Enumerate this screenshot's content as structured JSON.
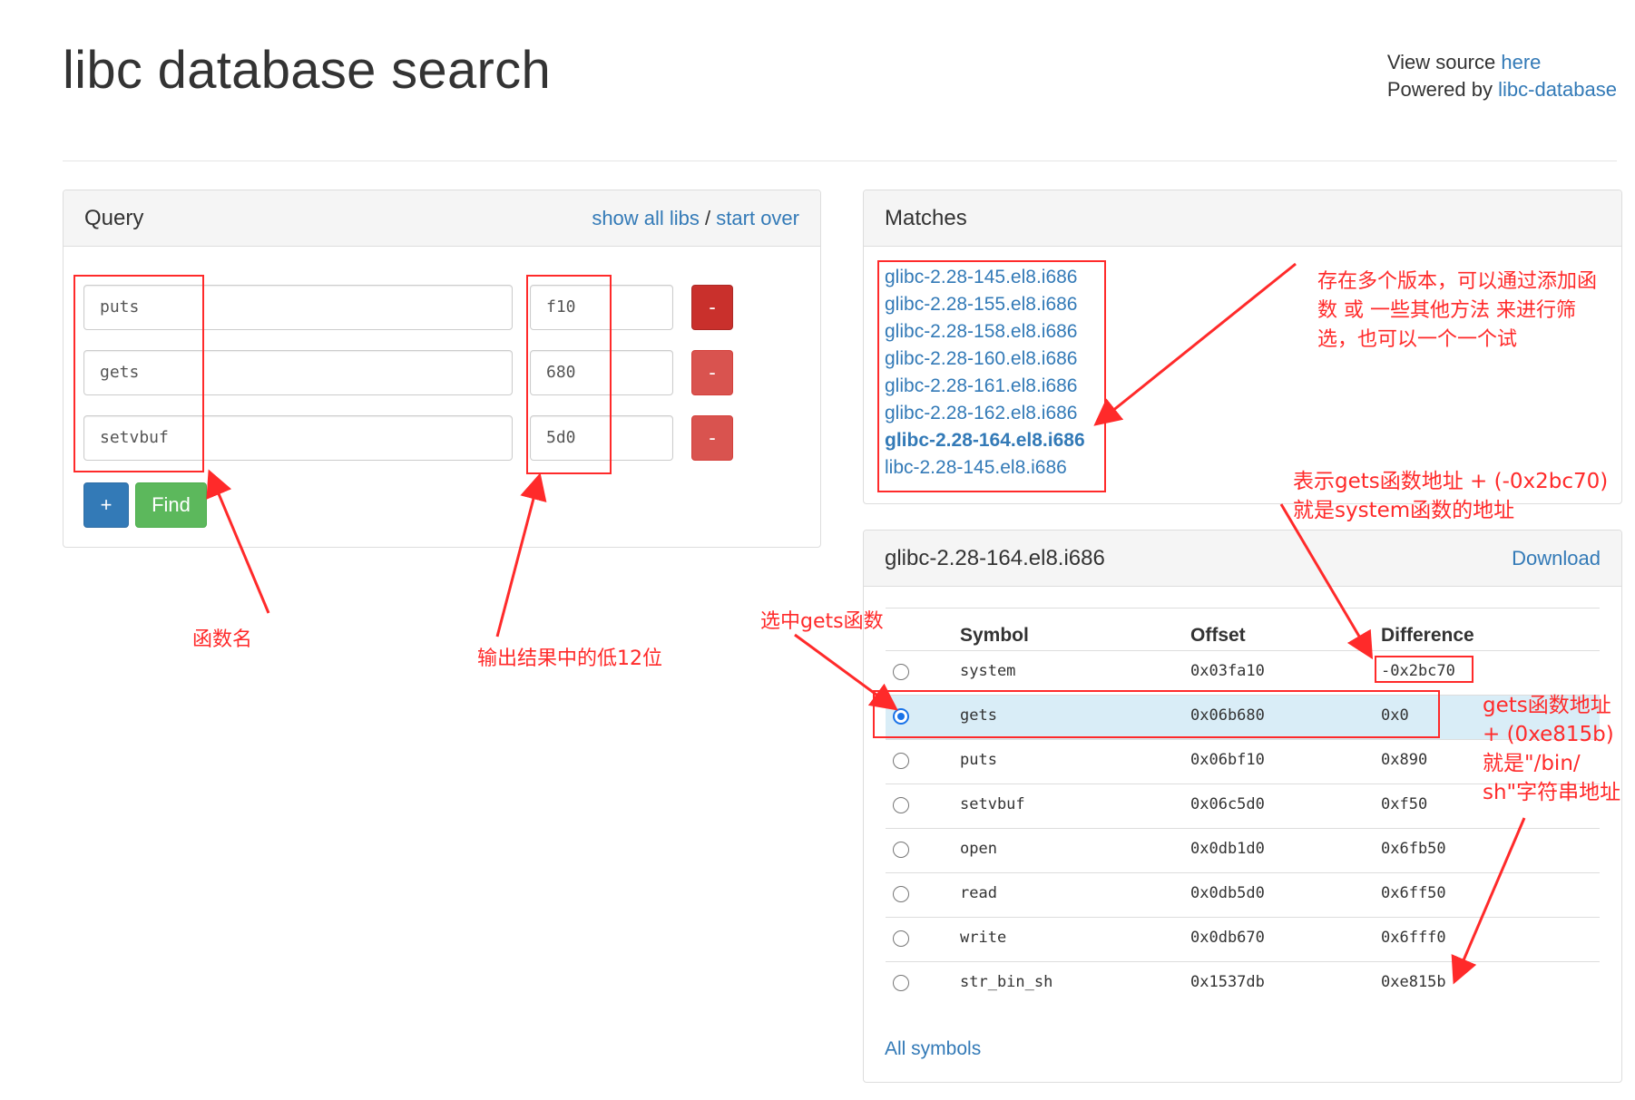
{
  "header": {
    "title": "libc database search",
    "view_source_prefix": "View source",
    "view_source_link": "here",
    "powered_by_prefix": "Powered by",
    "powered_by_link": "libc-database"
  },
  "query": {
    "title": "Query",
    "show_all_libs": "show all libs",
    "separator": "/",
    "start_over": "start over",
    "rows": [
      {
        "symbol": "puts",
        "address": "f10",
        "remove_label": "-"
      },
      {
        "symbol": "gets",
        "address": "680",
        "remove_label": "-"
      },
      {
        "symbol": "setvbuf",
        "address": "5d0",
        "remove_label": "-"
      }
    ],
    "add_label": "+",
    "find_label": "Find"
  },
  "matches": {
    "title": "Matches",
    "items": [
      "glibc-2.28-145.el8.i686",
      "glibc-2.28-155.el8.i686",
      "glibc-2.28-158.el8.i686",
      "glibc-2.28-160.el8.i686",
      "glibc-2.28-161.el8.i686",
      "glibc-2.28-162.el8.i686",
      "glibc-2.28-164.el8.i686",
      "libc-2.28-145.el8.i686"
    ],
    "selected": "glibc-2.28-164.el8.i686"
  },
  "libc_detail": {
    "title": "glibc-2.28-164.el8.i686",
    "download_label": "Download",
    "columns": [
      "Symbol",
      "Offset",
      "Difference"
    ],
    "rows": [
      {
        "symbol": "system",
        "offset": "0x03fa10",
        "difference": "-0x2bc70",
        "selected": false
      },
      {
        "symbol": "gets",
        "offset": "0x06b680",
        "difference": "0x0",
        "selected": true
      },
      {
        "symbol": "puts",
        "offset": "0x06bf10",
        "difference": "0x890",
        "selected": false
      },
      {
        "symbol": "setvbuf",
        "offset": "0x06c5d0",
        "difference": "0xf50",
        "selected": false
      },
      {
        "symbol": "open",
        "offset": "0x0db1d0",
        "difference": "0x6fb50",
        "selected": false
      },
      {
        "symbol": "read",
        "offset": "0x0db5d0",
        "difference": "0x6ff50",
        "selected": false
      },
      {
        "symbol": "write",
        "offset": "0x0db670",
        "difference": "0x6fff0",
        "selected": false
      },
      {
        "symbol": "str_bin_sh",
        "offset": "0x1537db",
        "difference": "0xe815b",
        "selected": false
      }
    ],
    "all_symbols_label": "All symbols"
  },
  "annotations": {
    "function_name": "函数名",
    "low12": "输出结果中的低12位",
    "versions_line1": "存在多个版本，可以通过添加函",
    "versions_line2": "数 或 一些其他方法 来进行筛",
    "versions_line3": "选，也可以一个一个试",
    "diff_line1": "表示gets函数地址 + (-0x2bc70)",
    "diff_line2": "就是system函数的地址",
    "select_gets": "选中gets函数",
    "binsh_line1": "gets函数地址",
    "binsh_line2": "+ (0xe815b)",
    "binsh_line3": "就是\"/bin/",
    "binsh_line4": "sh\"字符串地址"
  },
  "colors": {
    "link": "#337ab7",
    "danger": "#d9534f",
    "primary": "#337ab7",
    "success": "#5cb85c",
    "selected_row": "#d9edf7",
    "annotation": "#ff2a2a"
  }
}
